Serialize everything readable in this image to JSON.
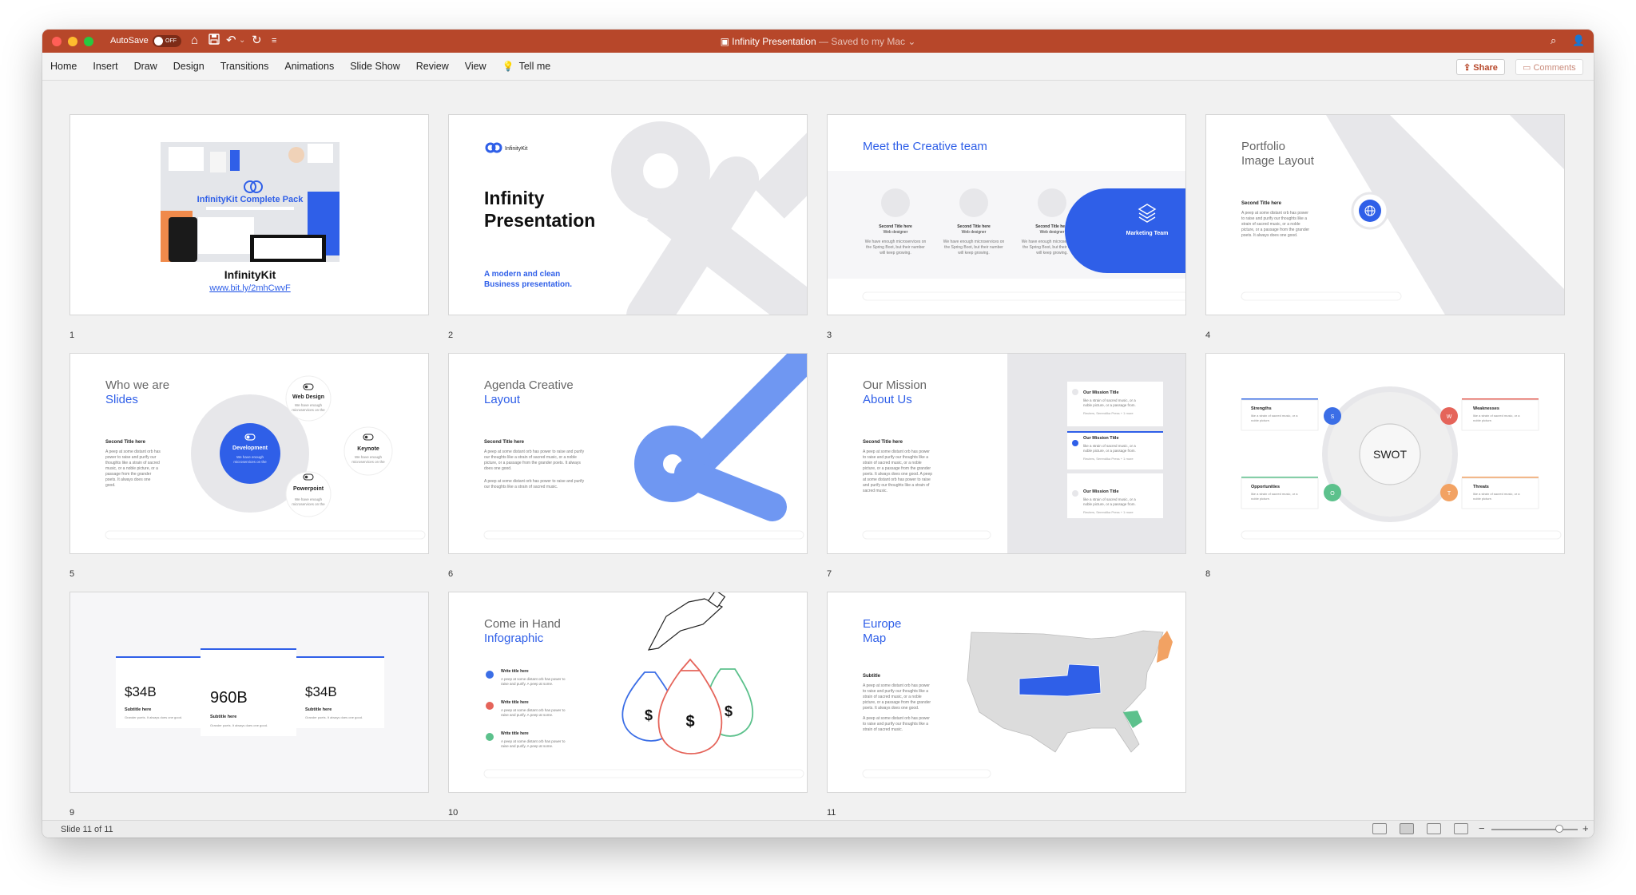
{
  "titlebar": {
    "autosave_label": "AutoSave",
    "autosave_state": "OFF",
    "doc_name": "Infinity Presentation",
    "doc_status": " — Saved to my Mac",
    "doc_icon": "doc-icon",
    "color": "#b7472a"
  },
  "ribbon": {
    "tabs": [
      "Home",
      "Insert",
      "Draw",
      "Design",
      "Transitions",
      "Animations",
      "Slide Show",
      "Review",
      "View"
    ],
    "tell_me": "Tell me",
    "share": "Share",
    "comments": "Comments"
  },
  "slides": [
    {
      "number": "1",
      "pack_title": "InfinityKit Complete Pack",
      "title": "InfinityKit",
      "link": "www.bit.ly/2mhCwvF"
    },
    {
      "number": "2",
      "brand": "InfinityKit",
      "title_line1": "Infinity",
      "title_line2": "Presentation",
      "sub_line1": "A modern and clean",
      "sub_line2": "Business presentation."
    },
    {
      "number": "3",
      "title": "Meet the Creative team",
      "member_title": "Second Title here",
      "member_role": "Web designer",
      "member_text_1": "We have enough microservices on",
      "member_text_2": "the Spring Boot, but their number",
      "member_text_3": "will keep growing.",
      "badge": "Marketing Team"
    },
    {
      "number": "4",
      "title_line1": "Portfolio",
      "title_line2": "Image Layout",
      "sub": "Second Title here",
      "body_1": "A peep at some distant orb has power",
      "body_2": "to raise and purify our thoughts like a",
      "body_3": "strain of sacred music, or a noble",
      "body_4": "picture, or a passage from the grander",
      "body_5": "poets. It always does one good."
    },
    {
      "number": "5",
      "title_line1": "Who we are",
      "title_line2": "Slides",
      "sub": "Second Title here",
      "body_1": "A peep at some distant orb has",
      "body_2": "power to raise and purify our",
      "body_3": "thoughts like a strain of sacred",
      "body_4": "music, or a noble picture, or a",
      "body_5": "passage from the grander",
      "body_6": "poets. It always does one",
      "body_7": "good.",
      "center": "Development",
      "center_text": "We have enough",
      "center_text_2": "microservices on the",
      "node1": "Web Design",
      "node2": "Keynote",
      "node3": "Powerpoint",
      "node_text": "We have enough",
      "node_text_2": "microservices on the"
    },
    {
      "number": "6",
      "title_line1": "Agenda Creative",
      "title_line2": "Layout",
      "sub": "Second Title here",
      "body_1": "A peep at some distant orb has power to raise and purify",
      "body_2": "our thoughts like a strain of sacred music, or a noble",
      "body_3": "picture, or a passage from the grander poets. It always",
      "body_4": "does one good.",
      "body_5": "A peep at some distant orb has power to raise and purify",
      "body_6": "our thoughts like a strain of sacred music."
    },
    {
      "number": "7",
      "title_line1": "Our Mission",
      "title_line2": "About Us",
      "sub": "Second Title here",
      "body_1": "A peep at some distant orb has power",
      "body_2": "to raise and purify our thoughts like a",
      "body_3": "strain of sacred music, or a noble",
      "body_4": "picture, or a passage from the grander",
      "body_5": "poets. It always does one good. A peep",
      "body_6": "at some distant orb has power to raise",
      "body_7": "and purify our thoughts like a strain of",
      "body_8": "sacred music.",
      "card_title": "Our Mission Title",
      "card_1": "like a strain of sacred music, or a",
      "card_2": "noble picture, or a passage from.",
      "card_meta": "Reuters, Serendika Press + 1 more"
    },
    {
      "number": "8",
      "center": "SWOT",
      "q1": "Strengths",
      "q2": "Weaknesses",
      "q3": "Opportunities",
      "q4": "Threats",
      "q_text_1": "like a strain of sacred music, or a",
      "q_text_2": "noble picture.",
      "l1": "S",
      "l2": "W",
      "l3": "O",
      "l4": "T"
    },
    {
      "number": "9",
      "v1": "$34B",
      "v2": "960B",
      "v3": "$34B",
      "subtitle": "Subtitle here",
      "caption": "Grander poets. It always does one good."
    },
    {
      "number": "10",
      "title_line1": "Come in Hand",
      "title_line2": "Infographic",
      "item_title": "Write title here",
      "item_text_1": "A peep at some distant orb has power to",
      "item_text_2": "raise and purify. A peep at some.",
      "dollar": "$"
    },
    {
      "number": "11",
      "title_line1": "Europe",
      "title_line2": "Map",
      "sub": "Subtitle",
      "body_1": "A peep at some distant orb has power",
      "body_2": "to raise and purify our thoughts like a",
      "body_3": "strain of sacred music, or a noble",
      "body_4": "picture, or a passage from the grander",
      "body_5": "poets. It always does one good.",
      "body_6": "A peep at some distant orb has power",
      "body_7": "to raise and purify our thoughts like a",
      "body_8": "strain of sacred music."
    }
  ],
  "status": {
    "slide_counter": "Slide 11 of 11"
  },
  "colors": {
    "accent": "#2f5fe8",
    "blue_light": "#6f97f2",
    "grey_shape": "#e7e7ea",
    "swot_s": "#3b6ee6",
    "swot_w": "#e5645a",
    "swot_o": "#5cc18c",
    "swot_t": "#f2a263"
  }
}
